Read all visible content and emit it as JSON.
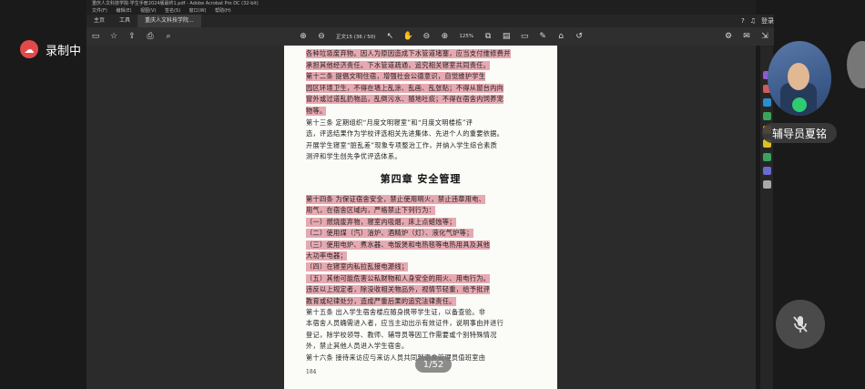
{
  "recorder": {
    "label": "录制中"
  },
  "window": {
    "title": "重庆人文科技学院-学生手册2024版最终1.pdf - Adobe Acrobat Pro DC (32-bit)",
    "menu": [
      "文件(F)",
      "编辑(E)",
      "视图(V)",
      "签名(S)",
      "窗口(W)",
      "帮助(H)"
    ],
    "tabs": [
      "主页",
      "工具"
    ],
    "doc_tab": "重庆人文科技学院...",
    "login": "登录"
  },
  "toolbar": {
    "page_indicator": "正文15 (36 / 50)",
    "zoom": "125%"
  },
  "document": {
    "lines": [
      {
        "text": "各种垃圾废弃物。因人为原因造成下水管道堵塞，应当支付维修费并",
        "hl": true
      },
      {
        "text": "承担其他经济责任。下水管道疏通，追究相关寝室共同责任。",
        "hl": true
      },
      {
        "text": "第十二条  提倡文明住宿，增强社会公德意识，自觉维护学生",
        "hl": true
      },
      {
        "text": "园区环境卫生，不得在墙上乱涂、乱画、乱张贴；不得从窗台内向",
        "hl": true
      },
      {
        "text": "窗外或过道乱扔物品，乱倒污水、随地吐痰；不得在宿舍内饲养宠",
        "hl": true
      },
      {
        "text": "物等。",
        "hl": true
      },
      {
        "text": "第十三条  定期组织“月度文明寝室”和“月度文明楼栋”评",
        "hl": false
      },
      {
        "text": "选，评选结果作为学校评选相关先进集体、先进个人的重要依据。",
        "hl": false
      },
      {
        "text": "开展学生寝室“脏乱差”现象专项整治工作，并纳入学生综合素质",
        "hl": false
      },
      {
        "text": "测评和学生创先争优评选体系。",
        "hl": false
      }
    ],
    "chapter_title": "第四章    安全管理",
    "lines2": [
      {
        "text": "第十四条  为保证宿舍安全，禁止使用明火，禁止违章用电、",
        "hl": true
      },
      {
        "text": "用气，在宿舍区域内，严格禁止下列行为：",
        "hl": true
      },
      {
        "text": "（一）燃烧废弃物，寝室内吸烟，床上点蜡烛等；",
        "hl": true
      },
      {
        "text": "（二）使用煤（汽）油炉、酒精炉（灯）、液化气炉等；",
        "hl": true
      },
      {
        "text": "（三）使用电炉、煮水器、电饭煲和电热毯等电热用具及其他",
        "hl": true
      },
      {
        "text": "大功率电器；",
        "hl": true
      },
      {
        "text": "（四）在寝室内私拉乱接电源线；",
        "hl": true
      },
      {
        "text": "（五）其他可能危害公私财物和人身安全的用火、用电行为。",
        "hl": true
      },
      {
        "text": "违反以上规定者，除没收相关物品外，视情节轻重，给予批评",
        "hl": true
      },
      {
        "text": "教育或纪律处分，造成严重后果的追究法律责任。",
        "hl": true
      },
      {
        "text": "第十五条  出入学生宿舍楼应随身携带学生证，以备查验。非",
        "hl": false
      },
      {
        "text": "本宿舍人员确需进入者，应当主动出示有效证件，说明事由并进行",
        "hl": false
      },
      {
        "text": "登记，除学校领导、教师、辅导员等因工作需要或个别特殊情况",
        "hl": false
      },
      {
        "text": "外，禁止其他人员进入学生宿舍。",
        "hl": false
      },
      {
        "text": "第十六条  接待来访应与来访人员共同到宿舍管理员值班室由",
        "hl": false
      }
    ],
    "page_number": "184"
  },
  "pager": {
    "label": "1/52"
  },
  "meeting": {
    "speaker_name": "辅导员夏铭",
    "colors": {
      "mic": "#2ecc71",
      "highlight": "#d66676"
    }
  }
}
